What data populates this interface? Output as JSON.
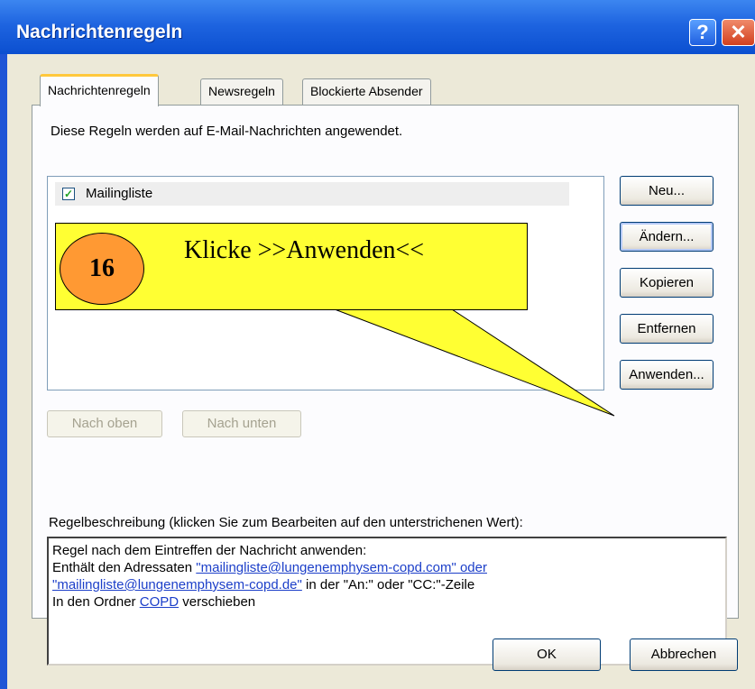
{
  "window": {
    "title": "Nachrichtenregeln",
    "help_glyph": "?",
    "close_glyph": "✕"
  },
  "tabs": [
    {
      "label": "Nachrichtenregeln"
    },
    {
      "label": "Newsregeln"
    },
    {
      "label": "Blockierte Absender"
    }
  ],
  "panel": {
    "description": "Diese Regeln werden auf E-Mail-Nachrichten angewendet."
  },
  "rules": [
    {
      "label": "Mailingliste",
      "checked": true
    }
  ],
  "side_buttons": {
    "neu": "Neu...",
    "aendern": "Ändern...",
    "kopieren": "Kopieren",
    "entfernen": "Entfernen",
    "anwenden": "Anwenden..."
  },
  "move_buttons": {
    "up": "Nach oben",
    "down": "Nach unten"
  },
  "rule_description": {
    "label": "Regelbeschreibung (klicken Sie zum Bearbeiten auf den unterstrichenen Wert):",
    "line1": "Regel nach dem Eintreffen der Nachricht anwenden:",
    "line2_prefix": "Enthält den Adressaten ",
    "link_address1": "\"mailingliste@lungenemphysem-copd.com\" oder",
    "link_address2": "\"mailingliste@lungenemphysem-copd.de\"",
    "line3_suffix": " in der \"An:\" oder \"CC:\"-Zeile",
    "line4_prefix": "In den Ordner ",
    "link_folder": "COPD",
    "line4_suffix": " verschieben"
  },
  "dialog_buttons": {
    "ok": "OK",
    "cancel": "Abbrechen"
  },
  "callout": {
    "step": "16",
    "text": "Klicke >>Anwenden<<"
  },
  "colors": {
    "callout_fill": "#ffff33",
    "badge_fill": "#ff9933",
    "link": "#1c3fc9",
    "titlebar": "#1e64e0"
  }
}
